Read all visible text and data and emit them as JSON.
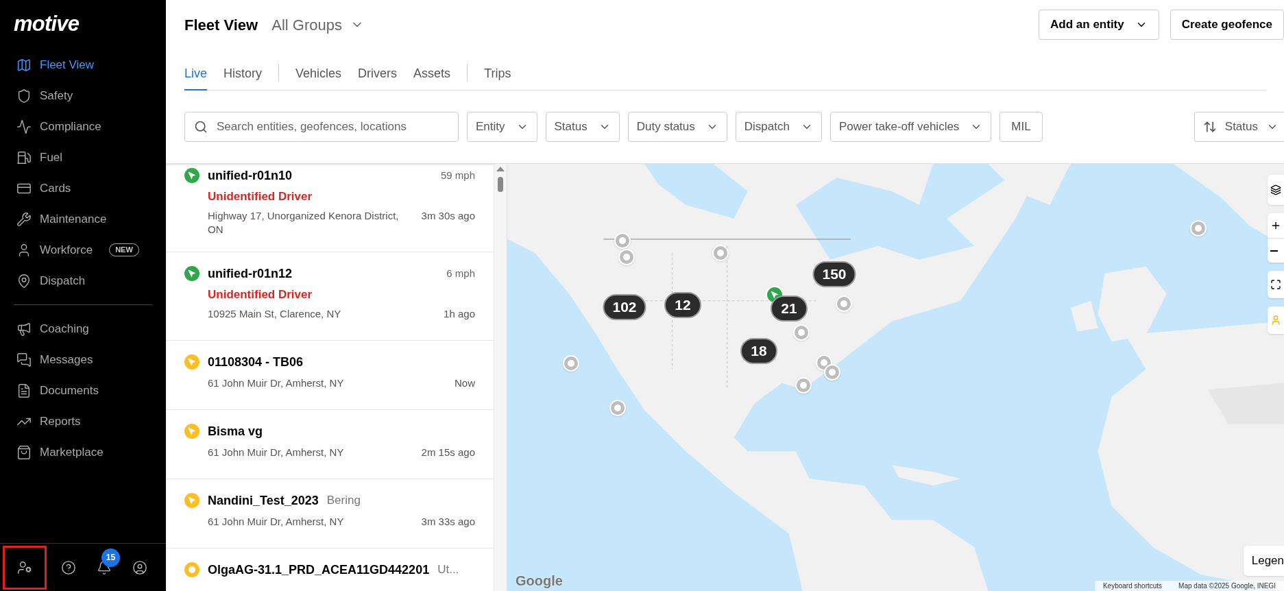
{
  "sidebar": {
    "logo": "motive",
    "sections": [
      [
        {
          "label": "Fleet View",
          "selected": true
        },
        {
          "label": "Safety",
          "selected": false
        },
        {
          "label": "Compliance",
          "selected": false
        },
        {
          "label": "Fuel",
          "selected": false
        },
        {
          "label": "Cards",
          "selected": false
        },
        {
          "label": "Maintenance",
          "selected": false
        },
        {
          "label": "Workforce",
          "selected": false,
          "badge": "NEW"
        },
        {
          "label": "Dispatch",
          "selected": false
        }
      ],
      [
        {
          "label": "Coaching",
          "selected": false
        },
        {
          "label": "Messages",
          "selected": false
        },
        {
          "label": "Documents",
          "selected": false
        },
        {
          "label": "Reports",
          "selected": false
        },
        {
          "label": "Marketplace",
          "selected": false
        }
      ]
    ],
    "footer": {
      "highlighted": true,
      "notification_count": "15"
    }
  },
  "header": {
    "title": "Fleet View",
    "group": "All Groups",
    "buttons": [
      "Add an entity",
      "Create geofence"
    ]
  },
  "tabs": [
    [
      {
        "label": "Live",
        "selected": true
      },
      {
        "label": "History",
        "selected": false
      }
    ],
    [
      {
        "label": "Vehicles",
        "selected": false
      },
      {
        "label": "Drivers",
        "selected": false
      },
      {
        "label": "Assets",
        "selected": false
      }
    ],
    [
      {
        "label": "Trips",
        "selected": false
      }
    ]
  ],
  "filters": {
    "search": {
      "placeholder": "Search entities, geofences, locations"
    },
    "dropdowns": [
      "Entity",
      "Status",
      "Duty status",
      "Dispatch",
      "Power take-off vehicles"
    ],
    "toggle": "MIL",
    "sort": "Status"
  },
  "vehicles": [
    {
      "name": "unified-r01n10",
      "kind": "arrow",
      "color": "#2ea84a",
      "speed": "59 mph",
      "driver": "Unidentified Driver",
      "address": "Highway 17, Unorganized Kenora District, ON",
      "time": "3m 30s ago"
    },
    {
      "name": "unified-r01n12",
      "kind": "arrow",
      "color": "#2ea84a",
      "speed": "6 mph",
      "driver": "Unidentified Driver",
      "address": "10925 Main St, Clarence, NY",
      "time": "1h ago"
    },
    {
      "name": "01108304 - TB06",
      "kind": "arrow",
      "color": "#fbbf24",
      "address": "61 John Muir Dr, Amherst, NY",
      "time": "Now"
    },
    {
      "name": "Bisma vg",
      "kind": "arrow",
      "color": "#fbbf24",
      "address": "61 John Muir Dr, Amherst, NY",
      "time": "2m 15s ago"
    },
    {
      "name": "Nandini_Test_2023",
      "tag": "Bering",
      "kind": "arrow",
      "color": "#fbbf24",
      "address": "61 John Muir Dr, Amherst, NY",
      "time": "3m 33s ago"
    },
    {
      "name": "OlgaAG-31.1_PRD_ACEA11GD442201",
      "tag": "Ut...",
      "kind": "ring",
      "color": "#fbbf24"
    }
  ],
  "map": {
    "clusters": [
      {
        "count": "150"
      },
      {
        "count": "102"
      },
      {
        "count": "12"
      },
      {
        "count": "21"
      },
      {
        "count": "18"
      }
    ],
    "legend": "Legen",
    "logo": "Google",
    "attribution": [
      "Keyboard shortcuts",
      "Map data ©2025 Google, INEGI"
    ]
  }
}
